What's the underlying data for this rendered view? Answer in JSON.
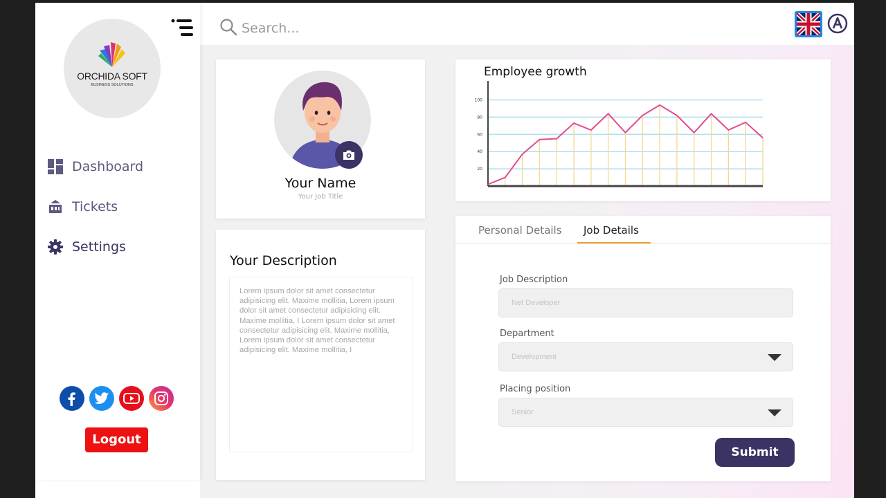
{
  "brand": {
    "name": "ORCHIDA SOFT",
    "tagline": "BUSINESS SOLUTIONS"
  },
  "sidebar": {
    "items": [
      {
        "label": "Dashboard",
        "icon": "dashboard-icon"
      },
      {
        "label": "Tickets",
        "icon": "tickets-icon"
      },
      {
        "label": "Settings",
        "icon": "gear-icon"
      }
    ],
    "socials": [
      "facebook-icon",
      "twitter-icon",
      "youtube-icon",
      "instagram-icon"
    ],
    "logout_label": "Logout"
  },
  "topbar": {
    "search_placeholder": "Search...",
    "language": "uk-flag-icon",
    "account_icon": "a-icon"
  },
  "profile": {
    "name": "Your Name",
    "job_title": "Your Job Title"
  },
  "description": {
    "title": "Your Description",
    "text": "Lorem ipsum dolor sit amet consectetur adipisicing elit. Maxime mollitia, Lorem ipsum dolor sit amet consectetur adipisicing elit. Maxime mollitia, I Lorem ipsum dolor sit amet consectetur adipisicing elit. Maxime mollitia, Lorem ipsum dolor sit amet consectetur adipisicing elit. Maxime mollitia, I"
  },
  "chart_data": {
    "type": "line",
    "title": "Employee growth",
    "xlabel": "",
    "ylabel": "",
    "yticks": [
      20,
      40,
      60,
      80,
      100
    ],
    "ylim": [
      0,
      118
    ],
    "values": [
      2,
      10,
      37,
      54,
      55,
      73,
      65,
      84,
      62,
      82,
      94,
      82,
      62,
      84,
      65,
      74,
      56
    ],
    "colors": {
      "line": "#e64a8c",
      "grid": "#aee0f0",
      "drop": "#f5d890",
      "axis": "#444444"
    }
  },
  "details": {
    "tabs": [
      {
        "label": "Personal Details"
      },
      {
        "label": "Job Details"
      }
    ],
    "active_tab": "Job Details",
    "fields": [
      {
        "label": "Job Description",
        "value": "Net Developer"
      },
      {
        "label": "Department",
        "value": "Development"
      },
      {
        "label": "Placing position",
        "value": "Senior"
      }
    ],
    "submit_label": "Submit"
  },
  "colors": {
    "primary": "#3b3363",
    "accent": "#f0a030",
    "danger": "#ee1111",
    "link": "#1e88e5"
  }
}
